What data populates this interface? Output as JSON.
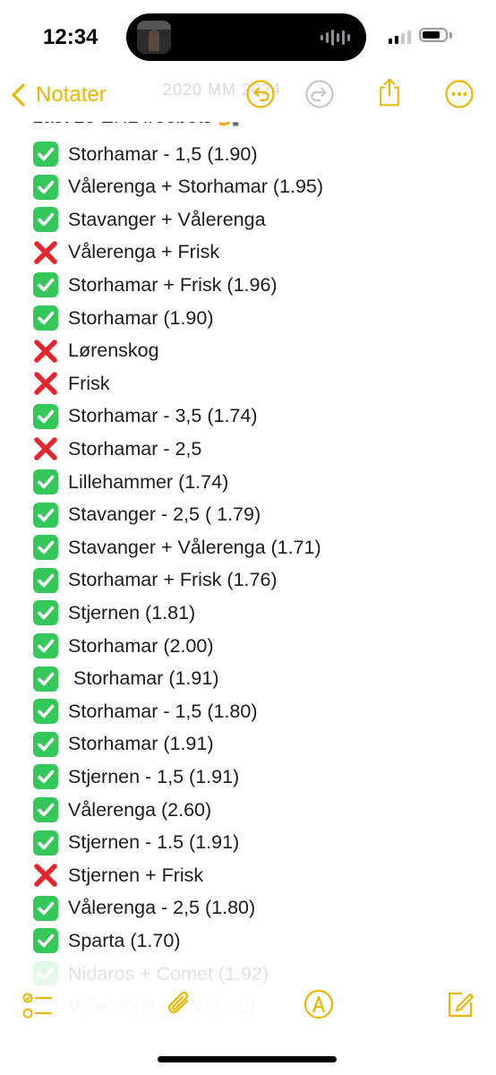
{
  "status_bar": {
    "time": "12:34",
    "battery_level": 0.78,
    "signal_bars_active": 2,
    "signal_bars_total": 4
  },
  "nav": {
    "back_label": "Notater",
    "faded_header_text": "2020 MM 2024"
  },
  "note": {
    "top_partial_line": "Last 28 EHL freebets 🏒",
    "lines": [
      {
        "status": "check",
        "text": "Storhamar - 1,5 (1.90)"
      },
      {
        "status": "check",
        "text": "Vålerenga + Storhamar (1.95)"
      },
      {
        "status": "check",
        "text": "Stavanger + Vålerenga"
      },
      {
        "status": "cross",
        "text": "Vålerenga + Frisk"
      },
      {
        "status": "check",
        "text": "Storhamar + Frisk (1.96)"
      },
      {
        "status": "check",
        "text": "Storhamar (1.90)"
      },
      {
        "status": "cross",
        "text": "Lørenskog"
      },
      {
        "status": "cross",
        "text": "Frisk"
      },
      {
        "status": "check",
        "text": "Storhamar - 3,5 (1.74)"
      },
      {
        "status": "cross",
        "text": "Storhamar - 2,5"
      },
      {
        "status": "check",
        "text": "Lillehammer (1.74)"
      },
      {
        "status": "check",
        "text": "Stavanger - 2,5 ( 1.79)"
      },
      {
        "status": "check",
        "text": "Stavanger + Vålerenga (1.71)"
      },
      {
        "status": "check",
        "text": "Storhamar + Frisk (1.76)"
      },
      {
        "status": "check",
        "text": "Stjernen (1.81)"
      },
      {
        "status": "check",
        "text": "Storhamar (2.00)"
      },
      {
        "status": "check",
        "text": " Storhamar (1.91)"
      },
      {
        "status": "check",
        "text": "Storhamar - 1,5 (1.80)"
      },
      {
        "status": "check",
        "text": "Storhamar (1.91)"
      },
      {
        "status": "check",
        "text": "Stjernen - 1,5 (1.91)"
      },
      {
        "status": "check",
        "text": "Vålerenga (2.60)"
      },
      {
        "status": "check",
        "text": "Stjernen - 1.5 (1.91)"
      },
      {
        "status": "cross",
        "text": "Stjernen + Frisk"
      },
      {
        "status": "check",
        "text": "Vålerenga - 2,5 (1.80)"
      },
      {
        "status": "check",
        "text": "Sparta (1.70)"
      }
    ],
    "faded_lines": [
      {
        "status": "check",
        "text": "Nidaros + Comet (1.92)"
      },
      {
        "status": "check",
        "text": "Vålerenga - 1,5 (2.00)"
      }
    ]
  },
  "icons": {
    "check": "check-mark-button-icon",
    "cross": "cross-mark-icon"
  },
  "colors": {
    "accent": "#E6B800",
    "check_green": "#34C759",
    "cross_red": "#E5242B",
    "text": "#1C1C1E"
  }
}
